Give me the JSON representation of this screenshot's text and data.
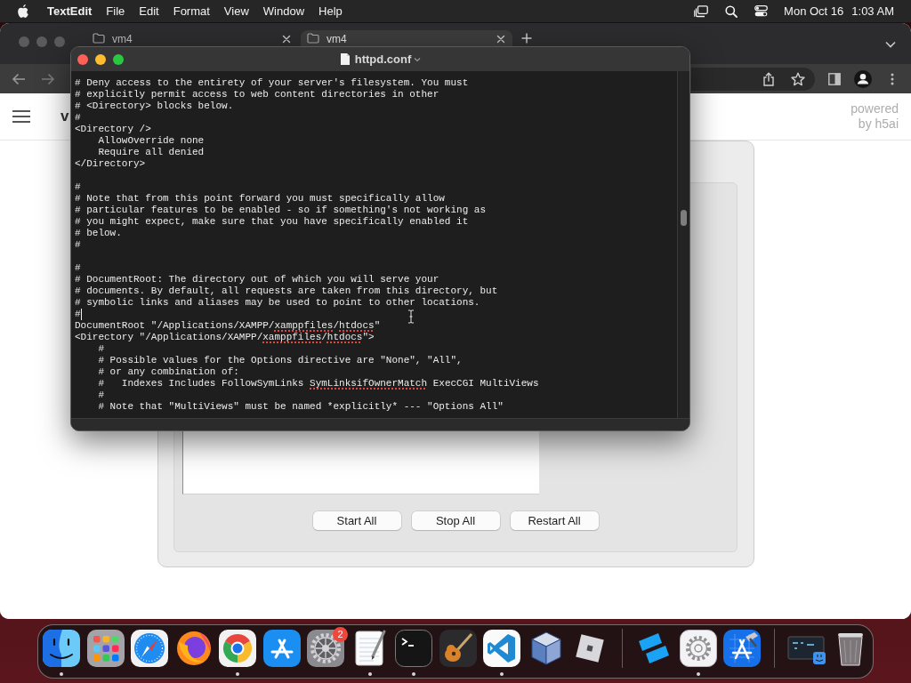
{
  "menu_bar": {
    "app_name": "TextEdit",
    "menus": [
      "File",
      "Edit",
      "Format",
      "View",
      "Window",
      "Help"
    ],
    "date": "Mon Oct 16",
    "time": "1:03 AM"
  },
  "browser": {
    "tabs": [
      {
        "title": "vm4",
        "selected": false
      },
      {
        "title": "vm4",
        "selected": true
      }
    ],
    "page": {
      "title": "v",
      "credit": "powered by h5ai"
    }
  },
  "manager_window": {
    "buttons": [
      "Start All",
      "Stop All",
      "Restart All"
    ]
  },
  "text_editor": {
    "title": "httpd.conf",
    "blocks": [
      [
        {
          "text": "# Deny access to the entirety of your server's filesystem. You must",
          "caret": false
        },
        {
          "text": "# explicitly permit access to web content directories in other",
          "caret": false
        },
        {
          "text": "# <Directory> blocks below.",
          "caret": false
        },
        {
          "text": "#",
          "caret": false
        },
        {
          "text": "<Directory />",
          "caret": false
        },
        {
          "text": "    AllowOverride none",
          "caret": false
        },
        {
          "text": "    Require all denied",
          "caret": false
        },
        {
          "text": "</Directory>",
          "caret": false
        }
      ],
      [
        {
          "text": "#",
          "caret": false
        },
        {
          "text": "# Note that from this point forward you must specifically allow",
          "caret": false
        },
        {
          "text": "# particular features to be enabled - so if something's not working as",
          "caret": false
        },
        {
          "text": "# you might expect, make sure that you have specifically enabled it",
          "caret": false
        },
        {
          "text": "# below.",
          "caret": false
        },
        {
          "text": "#",
          "caret": false
        }
      ],
      [
        {
          "text": "#",
          "caret": false
        },
        {
          "text": "# DocumentRoot: The directory out of which you will serve your",
          "caret": false
        },
        {
          "text": "# documents. By default, all requests are taken from this directory, but",
          "caret": false
        },
        {
          "text": "# symbolic links and aliases may be used to point to other locations.",
          "caret": false
        },
        {
          "text": "#",
          "caret": true
        },
        {
          "segments": [
            {
              "text": "DocumentRoot \"/Applications/XAMPP/",
              "misspelled": false
            },
            {
              "text": "xamppfiles",
              "misspelled": true
            },
            {
              "text": "/",
              "misspelled": false
            },
            {
              "text": "htdocs",
              "misspelled": true
            },
            {
              "text": "\"",
              "misspelled": false
            }
          ],
          "caret": false
        },
        {
          "segments": [
            {
              "text": "<Directory \"/Applications/XAMPP/",
              "misspelled": false
            },
            {
              "text": "xamppfiles",
              "misspelled": true
            },
            {
              "text": "/",
              "misspelled": false
            },
            {
              "text": "htdocs",
              "misspelled": true
            },
            {
              "text": "\">",
              "misspelled": false
            }
          ],
          "caret": false
        },
        {
          "text": "    #",
          "caret": false
        },
        {
          "text": "    # Possible values for the Options directive are \"None\", \"All\",",
          "caret": false
        },
        {
          "text": "    # or any combination of:",
          "caret": false
        },
        {
          "segments": [
            {
              "text": "    #   Indexes Includes FollowSymLinks ",
              "misspelled": false
            },
            {
              "text": "SymLinksifOwnerMatch",
              "misspelled": true
            },
            {
              "text": " ExecCGI MultiViews",
              "misspelled": false
            }
          ],
          "caret": false
        },
        {
          "text": "    #",
          "caret": false
        },
        {
          "text": "    # Note that \"MultiViews\" must be named *explicitly* --- \"Options All\"",
          "caret": false
        }
      ]
    ]
  },
  "dock": {
    "sections": [
      [
        {
          "running": true
        },
        {
          "running": false
        },
        {
          "running": false
        },
        {
          "running": false
        },
        {
          "running": true
        },
        {
          "running": false
        },
        {
          "running": false,
          "badge": "2"
        },
        {
          "running": true
        },
        {
          "running": true
        },
        {
          "running": false
        },
        {
          "running": true
        },
        {
          "running": false
        },
        {
          "running": false
        }
      ],
      [
        {
          "running": false
        },
        {
          "running": true
        },
        {
          "running": false
        }
      ],
      [
        {
          "running": false
        },
        {
          "running": false
        }
      ]
    ]
  }
}
